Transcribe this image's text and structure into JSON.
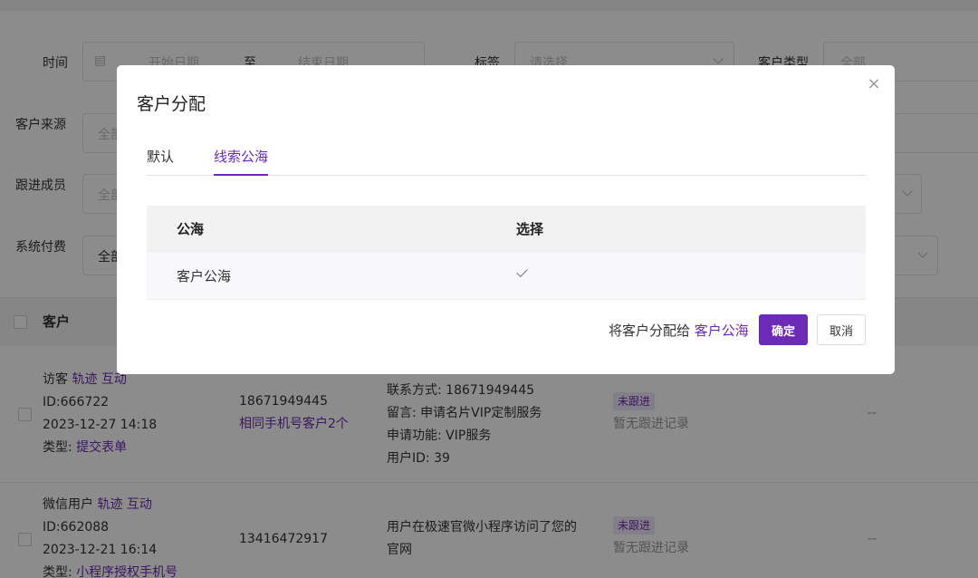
{
  "filters": {
    "time_label": "时间",
    "start_placeholder": "开始日期",
    "to": "至",
    "end_placeholder": "结束日期",
    "tag_label": "标签",
    "tag_placeholder": "请选择",
    "type_label": "客户类型",
    "type_value": "全部",
    "source_label": "客户来源",
    "source_value": "全部",
    "member_label": "跟进成员",
    "member_value": "全部",
    "pay_label": "系统付费",
    "pay_value": "全部"
  },
  "table": {
    "col_customer": "客户",
    "rows": [
      {
        "name": "访客",
        "link1": "轨迹",
        "link2": "互动",
        "id": "ID:666722",
        "date": "2023-12-27 14:18",
        "type_prefix": "类型: ",
        "type_value": "提交表单",
        "phone": "18671949445",
        "same_phone": "相同手机号客户2个",
        "info1": "联系方式: 18671949445",
        "info2": "留言: 申请名片VIP定制服务",
        "info3": "申请功能: VIP服务",
        "info4": "用户ID: 39",
        "status": "未跟进",
        "follow": "暂无跟进记录",
        "dash": "--"
      },
      {
        "name": "微信用户",
        "link1": "轨迹",
        "link2": "互动",
        "id": "ID:662088",
        "date": "2023-12-21 16:14",
        "type_prefix": "类型: ",
        "type_value": "小程序授权手机号",
        "phone": "13416472917",
        "info1": "用户在极速官微小程序访问了您的",
        "info2": "官网",
        "status": "未跟进",
        "follow": "暂无跟进记录",
        "dash": "--"
      }
    ]
  },
  "modal": {
    "title": "客户分配",
    "close_icon": "×",
    "tabs": [
      "默认",
      "线索公海"
    ],
    "active_tab": 1,
    "table": {
      "col1": "公海",
      "col2": "选择",
      "row1": "客户公海"
    },
    "assign_text": "将客户分配给",
    "assign_target": "客户公海",
    "ok_label": "确定",
    "cancel_label": "取消"
  },
  "colors": {
    "accent": "#6c2bb5"
  }
}
